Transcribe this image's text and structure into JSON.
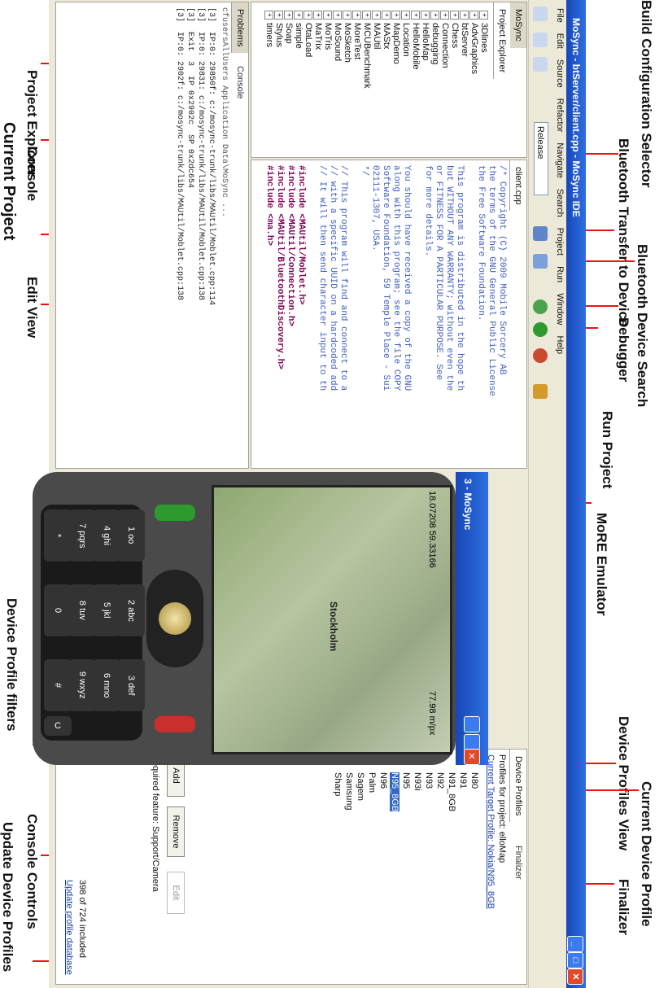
{
  "ide": {
    "title": "MoSync - btServer/client.cpp - MoSync IDE",
    "menu": [
      "File",
      "Edit",
      "Source",
      "Refactor",
      "Navigate",
      "Search",
      "Project",
      "Run",
      "Window",
      "Help"
    ],
    "build_config": "Release",
    "tabs": {
      "sync": "MoSync",
      "project_explorer": "Project Explorer",
      "editor": "client.cpp",
      "problems": "Problems",
      "console": "Console",
      "device_profiles": "Device Profiles",
      "finalizer": "Finalizer"
    },
    "projects": [
      "3Dlines",
      "AdvGraphics",
      "btServer",
      "Chess",
      "Connection",
      "debugging",
      "HelloMap",
      "HelloMobile",
      "Location",
      "MapDemo",
      "MAStx",
      "MAUtil",
      "MCUBenchmark",
      "MoreTest",
      "MoSketch",
      "MoSound",
      "MoTris",
      "MaTrix",
      "OtaLoad",
      "simple",
      "Soap",
      "Stylus",
      "timers"
    ],
    "editor_lines": [
      "/* Copyright (C) 2009 Mobile Sorcery AB",
      "the terms of the GNU General Public License",
      "the Free Software Foundation.",
      "",
      "This program is distributed in the hope th",
      "but WITHOUT ANY WARRANTY; without even the",
      "or FITNESS FOR A PARTICULAR PURPOSE. See",
      "for more details.",
      "",
      "You should have received a copy of the GNU",
      "along with this program; see the file COPY",
      "Software Foundation, 59 Temple Place - Sui",
      "02111-1307, USA.",
      "*/",
      "",
      "// This program will find and connect to a",
      "// with a specific UUID on a hardcoded add",
      "// It will then send character input to th",
      "",
      "#include <MAUtil/Moblet.h>",
      "#include <MAUtil/Connection.h>",
      "#include <MAUtil/BluetoothDiscovery.h>",
      "#include <ma.h>"
    ],
    "console_header": "cfusersAllUsers Application Data\\MoSync ... ",
    "console_lines": [
      "[3]  IP:0: 29850f: c:/mosync-trunk/libs/MAUtil/Moblet.cpp:114",
      "[3]  IP:0: 29831: c:/mosync-trunk/libs/MAUtil/Moblet.cpp:138",
      "[3]  Exit  3  IP 0x2902c  SP 0x2dc654",
      "[3]  IP:0: 2902f: c:/mosync-trunk/libs/MAUtil/Moblet.cpp:138"
    ],
    "profiles": {
      "for_project": "Profiles for project: elloMap",
      "current": "Current Target Profile: Nokia/N95_8GB",
      "vendors": [
        "N80",
        "N91",
        "N91_8GB",
        "N92",
        "N93",
        "N93i",
        "N95",
        "N95_8GB",
        "N96",
        "Palm",
        "Sagem",
        "Samsung",
        "Sharp"
      ],
      "selected": "N95_8GB",
      "buttons": {
        "add": "Add",
        "remove": "Remove",
        "edit": "Edit"
      },
      "filter": "Required feature: Support/Camera",
      "count": "398 of 724 included",
      "update_link": "Update profile database"
    },
    "emulator": {
      "title": "3 - MoSync",
      "gps": "18.07208 59.33166",
      "scale": "77.98 m/px",
      "city": "Stockholm",
      "keys": [
        "1 oo",
        "2 abc",
        "3 def",
        "4 ghi",
        "5 jkl",
        "6 mno",
        "7 pqrs",
        "8 tuv",
        "9 wxyz",
        "*",
        "0",
        "#"
      ],
      "c_key": "C"
    }
  },
  "annotations": [
    "Project Explorer",
    "Build Configuration Selector",
    "Current Project",
    "Console",
    "Bluetooth Transfer to Device",
    "Edit View",
    "Bluetooth Device Search",
    "Debugger",
    "Run Project",
    "MoRE Emulator",
    "Device Profile filters",
    "Console Controls",
    "Update Device Profiles",
    "Device Profiles View",
    "Current Device Profile",
    "Finalizer"
  ],
  "colors": {
    "title": "#1747b8",
    "accent": "#ff0000",
    "chrome": "#ece9d8"
  }
}
